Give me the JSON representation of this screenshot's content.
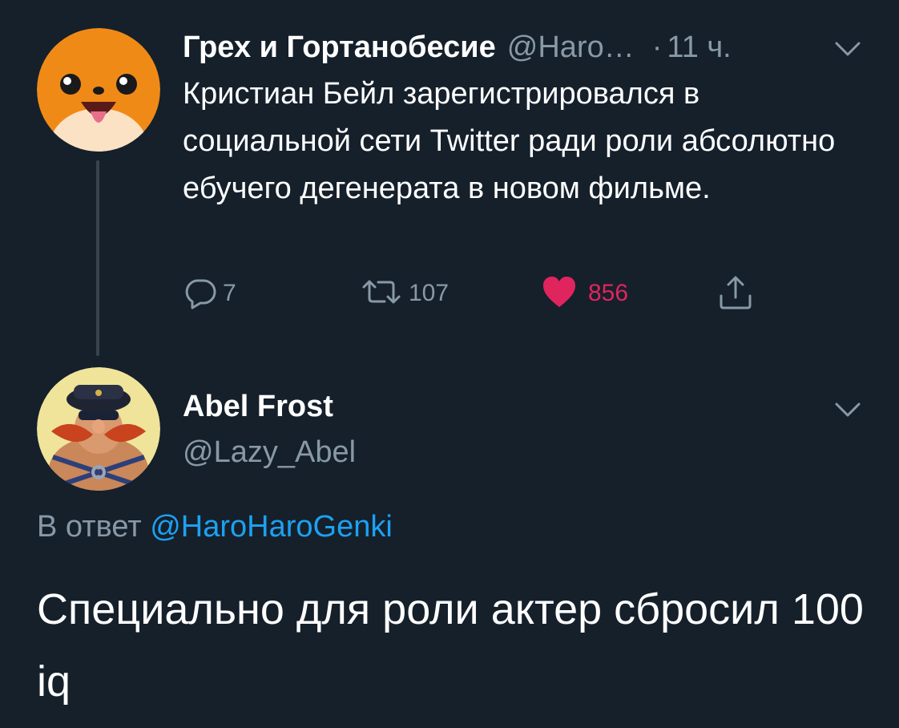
{
  "tweet1": {
    "author_name": "Грех и Гортанобесие",
    "author_handle": "@Haro…",
    "separator": "·",
    "time": "11 ч.",
    "text": "Кристиан Бейл зарегистрировался в социальной сети Twitter ради роли абсолютно ебучего дегенерата в новом фильме.",
    "replies": "7",
    "retweets": "107",
    "likes": "856",
    "liked": true,
    "icons": [
      "reply-icon",
      "retweet-icon",
      "heart-icon",
      "share-icon",
      "chevron-down-icon"
    ]
  },
  "tweet2": {
    "author_name": "Abel Frost",
    "author_handle": "@Lazy_Abel",
    "reply_prefix": "В ответ",
    "reply_to": "@HaroHaroGenki",
    "text": "Специально для роли актер сбросил 100 iq",
    "icons": [
      "chevron-down-icon"
    ]
  },
  "colors": {
    "background": "#15202b",
    "secondary_text": "#8899a6",
    "link": "#1da1f2",
    "like": "#e0245e",
    "thread_line": "#38444d"
  }
}
